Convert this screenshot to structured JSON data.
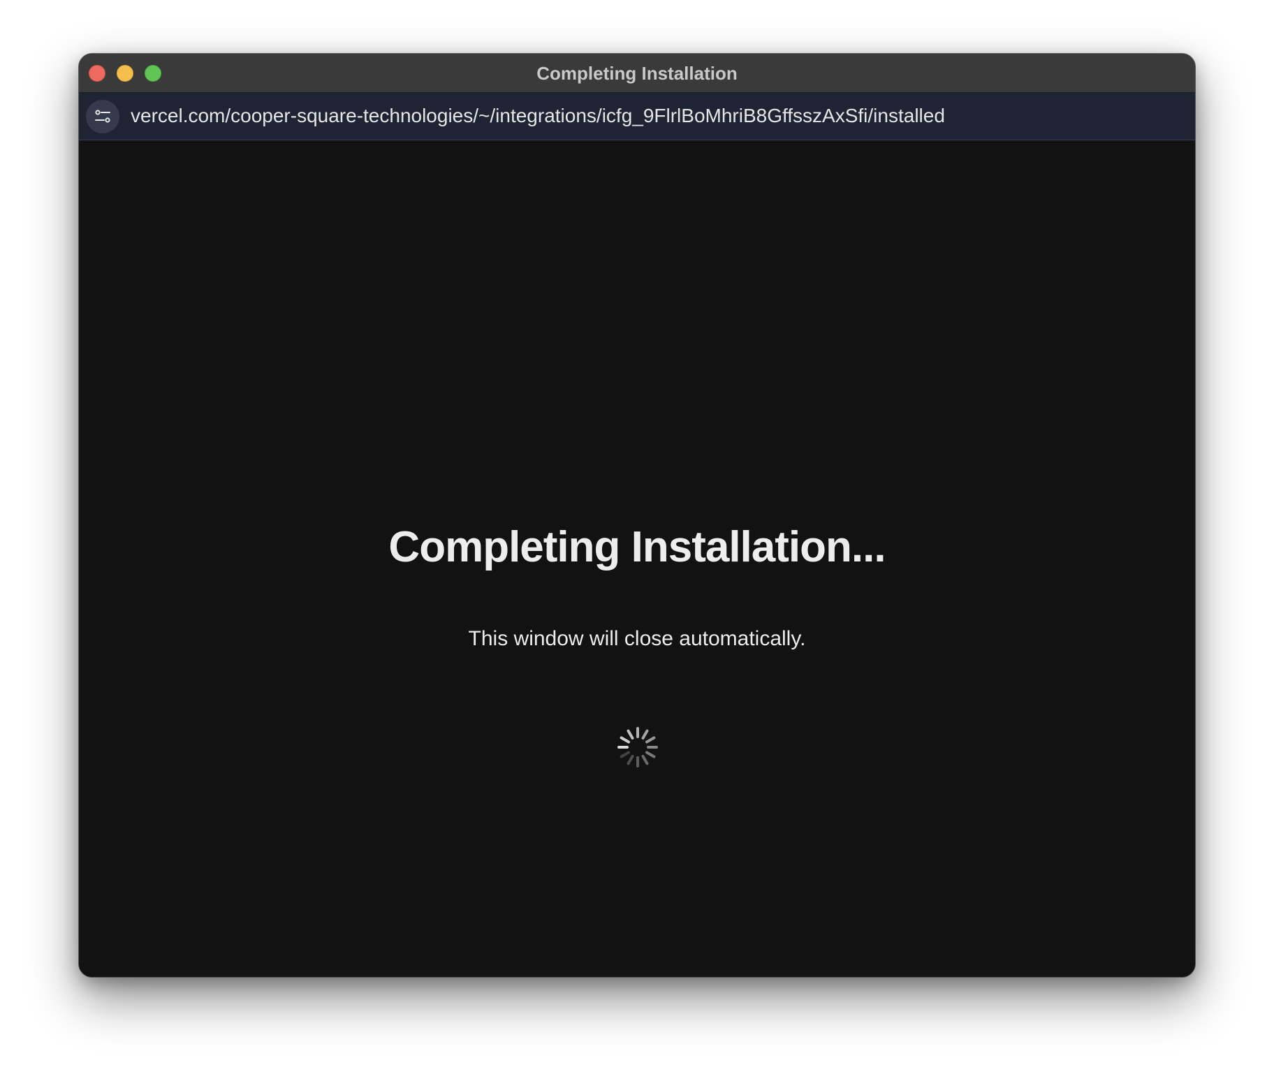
{
  "window": {
    "title": "Completing Installation"
  },
  "address_bar": {
    "url": "vercel.com/cooper-square-technologies/~/integrations/icfg_9FlrlBoMhriB8GffsszAxSfi/installed",
    "icon": "site-settings-icon"
  },
  "main": {
    "heading": "Completing Installation...",
    "message": "This window will close automatically.",
    "loader_icon": "spinner-icon"
  },
  "colors": {
    "titlebar": "#3a3a3a",
    "address_bar": "#1f2434",
    "content_background": "#121212",
    "text": "#ededed",
    "traffic_close": "#ec6a5e",
    "traffic_minimize": "#f4bf4f",
    "traffic_zoom": "#61c554"
  }
}
